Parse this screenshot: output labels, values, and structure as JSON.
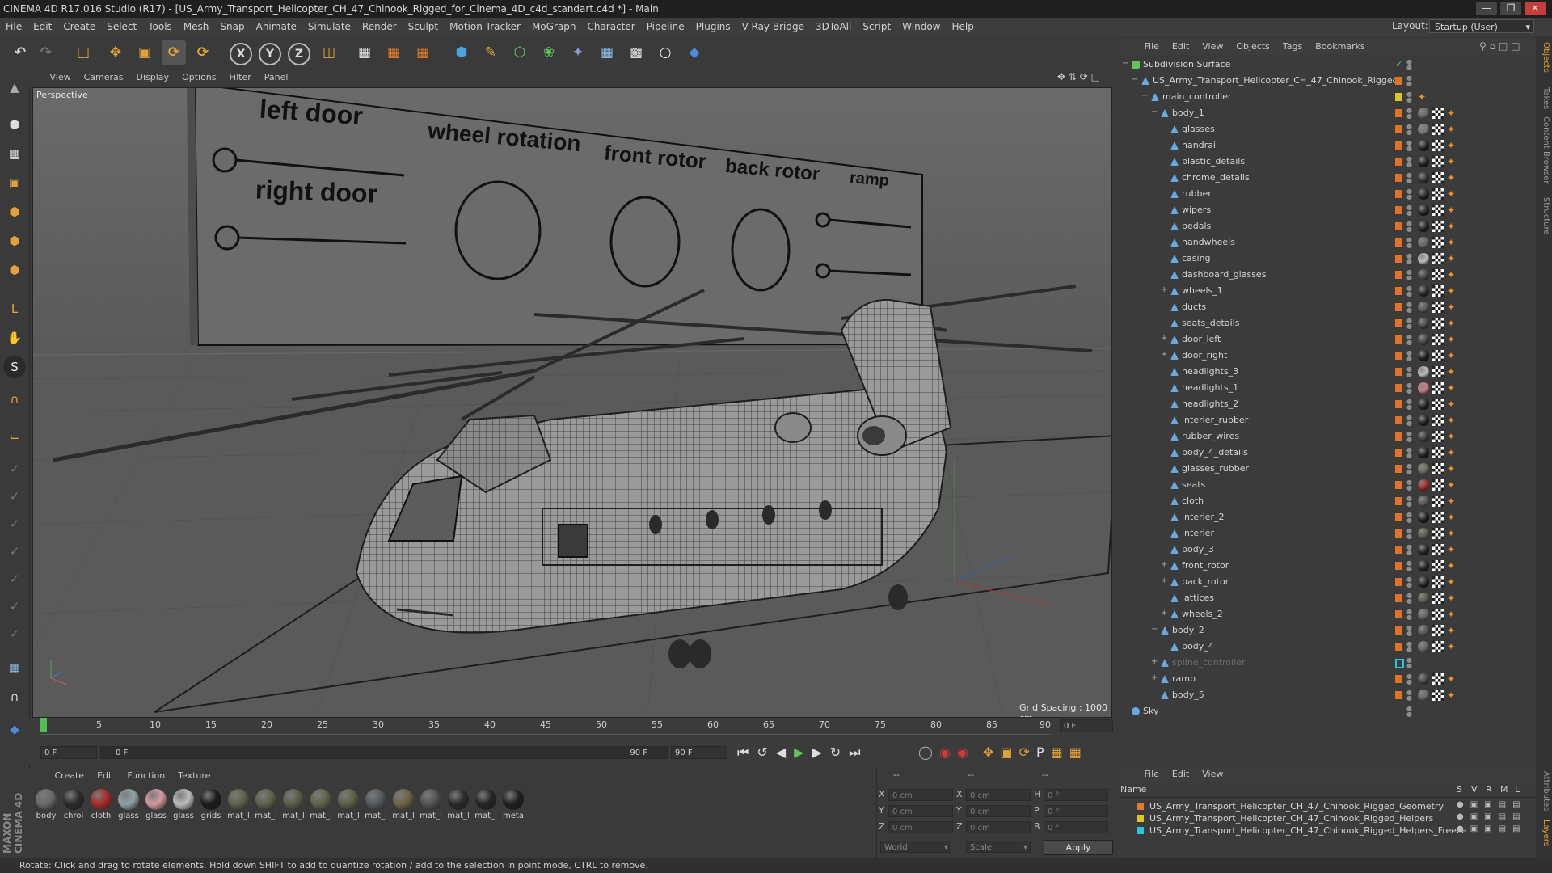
{
  "window": {
    "title": "CINEMA 4D R17.016 Studio (R17) - [US_Army_Transport_Helicopter_CH_47_Chinook_Rigged_for_Cinema_4D_c4d_standart.c4d *] - Main"
  },
  "menubar": [
    "File",
    "Edit",
    "Create",
    "Select",
    "Tools",
    "Mesh",
    "Snap",
    "Animate",
    "Simulate",
    "Render",
    "Sculpt",
    "Motion Tracker",
    "MoGraph",
    "Character",
    "Pipeline",
    "Plugins",
    "V-Ray Bridge",
    "3DToAll",
    "Script",
    "Window",
    "Help"
  ],
  "layout": {
    "label": "Layout:",
    "value": "Startup (User)"
  },
  "toolbar": {
    "axis_x": "X",
    "axis_y": "Y",
    "axis_z": "Z"
  },
  "viewport": {
    "menu": [
      "View",
      "Cameras",
      "Display",
      "Options",
      "Filter",
      "Panel"
    ],
    "label": "Perspective",
    "grid_spacing": "Grid Spacing : 1000 cm",
    "board_labels": {
      "left_door": "left door",
      "right_door": "right door",
      "wheel_rotation": "wheel rotation",
      "front_rotor": "front rotor",
      "back_rotor": "back rotor",
      "ramp": "ramp"
    }
  },
  "timeline": {
    "ticks": [
      "0",
      "5",
      "10",
      "15",
      "20",
      "25",
      "30",
      "35",
      "40",
      "45",
      "50",
      "55",
      "60",
      "65",
      "70",
      "75",
      "80",
      "85",
      "90"
    ],
    "frame_end_display": "0 F",
    "current_frame": "0 F",
    "range_start": "0 F",
    "range_end": "90 F",
    "max_frame": "90 F"
  },
  "materials": {
    "menu": [
      "Create",
      "Edit",
      "Function",
      "Texture"
    ],
    "items": [
      {
        "label": "body",
        "color": "#6b6b6b"
      },
      {
        "label": "chroi",
        "color": "#2a2a2a"
      },
      {
        "label": "cloth",
        "color": "#a92a2a"
      },
      {
        "label": "glass",
        "color": "#8fa4a8"
      },
      {
        "label": "glass",
        "color": "#d49aa0"
      },
      {
        "label": "glass",
        "color": "#bcbcbc"
      },
      {
        "label": "grids",
        "color": "#1a1a1a"
      },
      {
        "label": "mat_l",
        "color": "#5f6148"
      },
      {
        "label": "mat_l",
        "color": "#5e6149"
      },
      {
        "label": "mat_l",
        "color": "#5b5d46"
      },
      {
        "label": "mat_l",
        "color": "#616248"
      },
      {
        "label": "mat_l",
        "color": "#5e5f46"
      },
      {
        "label": "mat_l",
        "color": "#55595c"
      },
      {
        "label": "mat_l",
        "color": "#6b6446"
      },
      {
        "label": "mat_l",
        "color": "#535353"
      },
      {
        "label": "mat_l",
        "color": "#2a2a2a"
      },
      {
        "label": "mat_l",
        "color": "#242424"
      },
      {
        "label": "meta",
        "color": "#1e1e1e"
      }
    ]
  },
  "coords": {
    "x1": "X",
    "y1": "Y",
    "z1": "Z",
    "x2": "X",
    "y2": "Y",
    "z2": "Z",
    "h": "H",
    "p": "P",
    "b": "B",
    "pos_x": "0 cm",
    "pos_y": "0 cm",
    "pos_z": "0 cm",
    "size_x": "0 cm",
    "size_y": "0 cm",
    "size_z": "0 cm",
    "rot_h": "0 °",
    "rot_p": "0 °",
    "rot_b": "0 °",
    "dash1": "--",
    "dash2": "--",
    "dash3": "--",
    "mode": "World",
    "scale": "Scale",
    "apply": "Apply"
  },
  "objects": {
    "menu": [
      "File",
      "Edit",
      "View",
      "Objects",
      "Tags",
      "Bookmarks"
    ],
    "rows": [
      {
        "name": "Subdivision Surface",
        "indent": 0
      },
      {
        "name": "US_Army_Transport_Helicopter_CH_47_Chinook_Rigged",
        "indent": 1
      },
      {
        "name": "main_controller",
        "indent": 2
      },
      {
        "name": "body_1",
        "indent": 3
      },
      {
        "name": "glasses",
        "indent": 4
      },
      {
        "name": "handrail",
        "indent": 4
      },
      {
        "name": "plastic_details",
        "indent": 4
      },
      {
        "name": "chrome_details",
        "indent": 4
      },
      {
        "name": "rubber",
        "indent": 4
      },
      {
        "name": "wipers",
        "indent": 4
      },
      {
        "name": "pedals",
        "indent": 4
      },
      {
        "name": "handwheels",
        "indent": 4
      },
      {
        "name": "casing",
        "indent": 4
      },
      {
        "name": "dashboard_glasses",
        "indent": 4
      },
      {
        "name": "wheels_1",
        "indent": 4
      },
      {
        "name": "ducts",
        "indent": 4
      },
      {
        "name": "seats_details",
        "indent": 4
      },
      {
        "name": "door_left",
        "indent": 4
      },
      {
        "name": "door_right",
        "indent": 4
      },
      {
        "name": "headlights_3",
        "indent": 4
      },
      {
        "name": "headlights_1",
        "indent": 4
      },
      {
        "name": "headlights_2",
        "indent": 4
      },
      {
        "name": "interier_rubber",
        "indent": 4
      },
      {
        "name": "rubber_wires",
        "indent": 4
      },
      {
        "name": "body_4_details",
        "indent": 4
      },
      {
        "name": "glasses_rubber",
        "indent": 4
      },
      {
        "name": "seats",
        "indent": 4
      },
      {
        "name": "cloth",
        "indent": 4
      },
      {
        "name": "interier_2",
        "indent": 4
      },
      {
        "name": "interier",
        "indent": 4
      },
      {
        "name": "body_3",
        "indent": 4
      },
      {
        "name": "front_rotor",
        "indent": 4
      },
      {
        "name": "back_rotor",
        "indent": 4
      },
      {
        "name": "lattices",
        "indent": 4
      },
      {
        "name": "wheels_2",
        "indent": 4
      },
      {
        "name": "body_2",
        "indent": 3
      },
      {
        "name": "body_4",
        "indent": 4
      },
      {
        "name": "spline_controller",
        "indent": 3
      },
      {
        "name": "ramp",
        "indent": 3
      },
      {
        "name": "body_5",
        "indent": 3
      },
      {
        "name": "Sky",
        "indent": 0
      }
    ]
  },
  "layers": {
    "menu": [
      "File",
      "Edit",
      "View"
    ],
    "header": {
      "name": "Name",
      "s": "S",
      "v": "V",
      "r": "R",
      "m": "M",
      "l": "L"
    },
    "items": [
      {
        "name": "US_Army_Transport_Helicopter_CH_47_Chinook_Rigged_Geometry",
        "color": "#e07a2a"
      },
      {
        "name": "US_Army_Transport_Helicopter_CH_47_Chinook_Rigged_Helpers",
        "color": "#d9c72a"
      },
      {
        "name": "US_Army_Transport_Helicopter_CH_47_Chinook_Rigged_Helpers_Freeze",
        "color": "#2ac6d9"
      }
    ]
  },
  "right_tabs": [
    "Objects",
    "Takes",
    "Content Browser",
    "Structure",
    "Attributes",
    "Layers"
  ],
  "status": "Rotate: Click and drag to rotate elements. Hold down SHIFT to add to quantize rotation / add to the selection in point mode, CTRL to remove."
}
